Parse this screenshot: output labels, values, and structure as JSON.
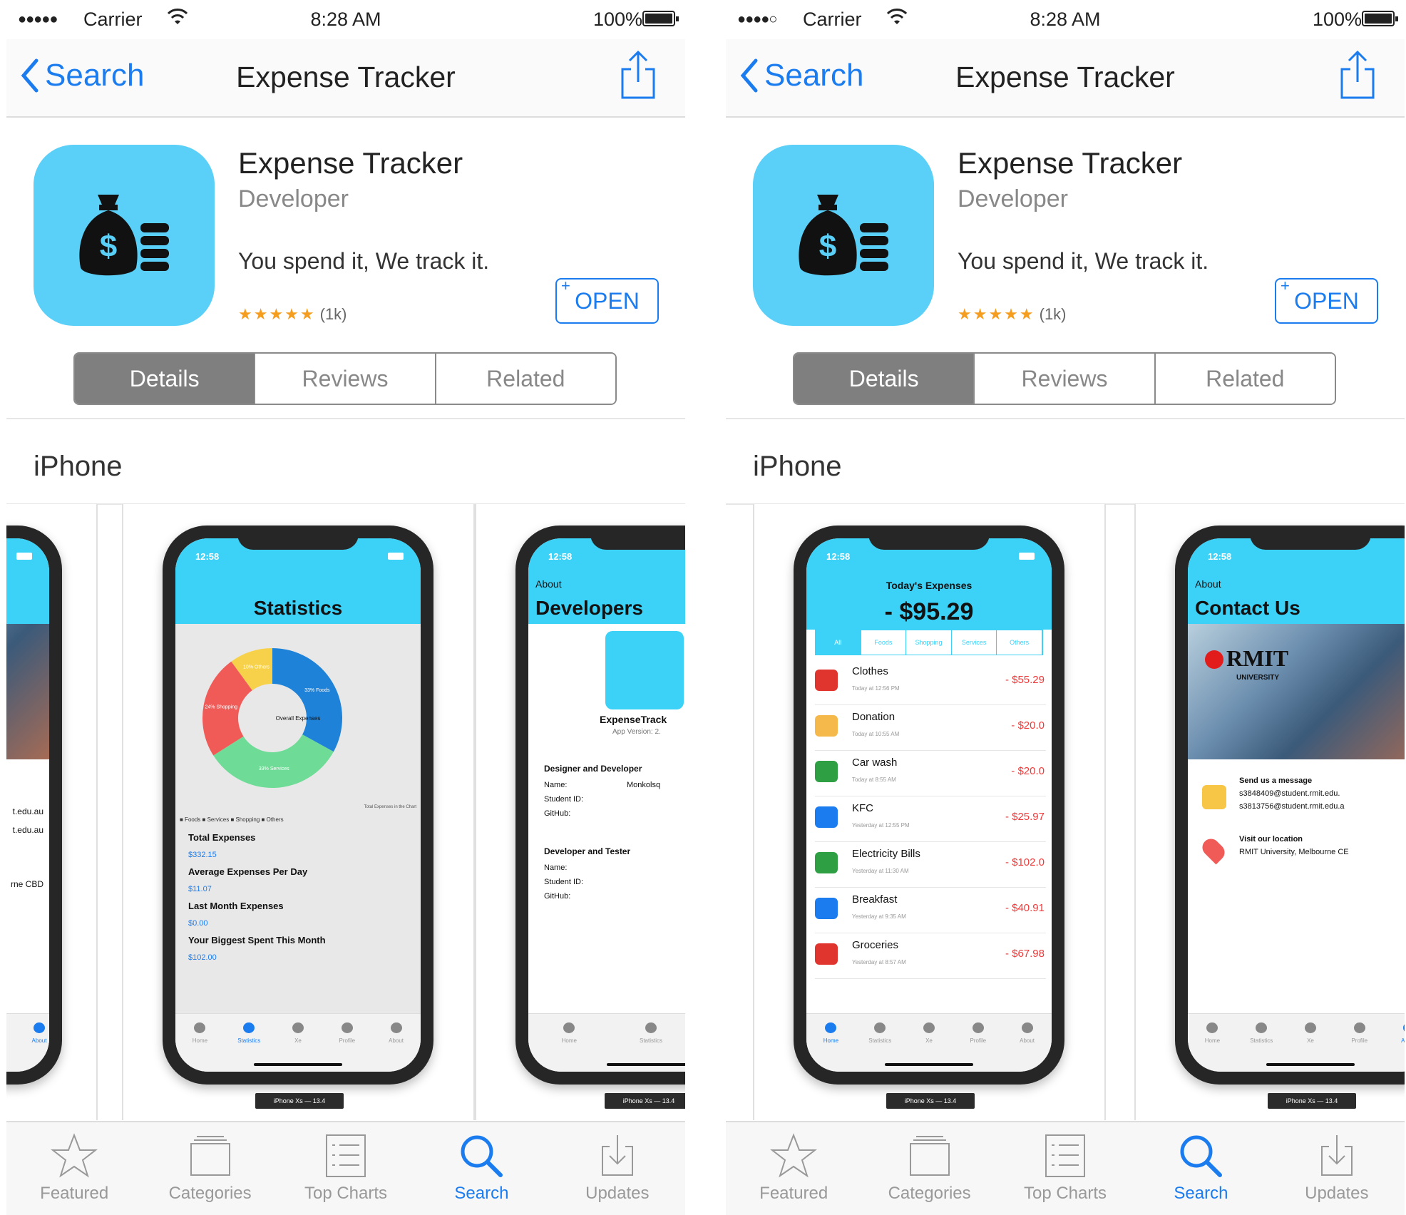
{
  "status": {
    "signal_left": "●●●●●",
    "signal_right": "●●●●○",
    "carrier": "Carrier",
    "time": "8:28 AM",
    "battery": "100%"
  },
  "nav": {
    "back_label": "Search",
    "title": "Expense Tracker"
  },
  "app": {
    "name": "Expense Tracker",
    "developer": "Developer",
    "tagline": "You spend it, We track it.",
    "stars": "★★★★★",
    "rating_count": "(1k)",
    "open_label": "OPEN",
    "open_plus": "+"
  },
  "segments": [
    {
      "label": "Details",
      "selected": true
    },
    {
      "label": "Reviews",
      "selected": false
    },
    {
      "label": "Related",
      "selected": false
    }
  ],
  "section_title": "iPhone",
  "screens": {
    "device_label": "iPhone Xs — 13.4",
    "statistics": {
      "time": "12:58",
      "title": "Statistics",
      "chart_center": "Overall Expenses",
      "chart_note": "Total Expenses in the Chart",
      "slices": [
        {
          "label": "33% Foods",
          "value": 33,
          "color": "#1e82d8"
        },
        {
          "label": "33% Services",
          "value": 33,
          "color": "#6edc96"
        },
        {
          "label": "24% Shopping",
          "value": 24,
          "color": "#f05a57"
        },
        {
          "label": "10% Others",
          "value": 10,
          "color": "#f7d14a"
        }
      ],
      "legend": "■ Foods ■ Services ■ Shopping ■ Others",
      "rows": [
        {
          "label": "Total Expenses",
          "value": "$332.15"
        },
        {
          "label": "Average Expenses Per Day",
          "value": "$11.07"
        },
        {
          "label": "Last Month Expenses",
          "value": "$0.00"
        },
        {
          "label": "Your Biggest Spent This Month",
          "value": "$102.00"
        }
      ],
      "tabs": [
        "Home",
        "Statistics",
        "Xe",
        "Profile",
        "About"
      ]
    },
    "developers": {
      "time": "12:58",
      "back": "About",
      "title": "Developers",
      "app_name": "ExpenseTrack",
      "version": "App Version: 2.",
      "group1": "Designer and Developer",
      "group2": "Developer and Tester",
      "name_label": "Name:",
      "name_value": "Monkolsq",
      "student_label": "Student ID:",
      "github_label": "GitHub:"
    },
    "left_partial": {
      "lines": [
        "t.edu.au",
        "t.edu.au",
        "rne CBD"
      ],
      "tab": "About"
    },
    "today": {
      "time": "12:58",
      "header": "Today's Expenses",
      "amount": "- $95.29",
      "filters": [
        "All",
        "Foods",
        "Shopping",
        "Services",
        "Others"
      ],
      "items": [
        {
          "name": "Clothes",
          "time": "Today at 12:56 PM",
          "amount": "- $55.29",
          "color": "#e0342e"
        },
        {
          "name": "Donation",
          "time": "Today at 10:55 AM",
          "amount": "- $20.0",
          "color": "#f5b84a"
        },
        {
          "name": "Car wash",
          "time": "Today at 8:55 AM",
          "amount": "- $20.0",
          "color": "#2ea043"
        },
        {
          "name": "KFC",
          "time": "Yesterday at 12:55 PM",
          "amount": "- $25.97",
          "color": "#1b7cef"
        },
        {
          "name": "Electricity Bills",
          "time": "Yesterday at 11:30 AM",
          "amount": "- $102.0",
          "color": "#2ea043"
        },
        {
          "name": "Breakfast",
          "time": "Yesterday at 9:35 AM",
          "amount": "- $40.91",
          "color": "#1b7cef"
        },
        {
          "name": "Groceries",
          "time": "Yesterday at 8:57 AM",
          "amount": "- $67.98",
          "color": "#e0342e"
        }
      ]
    },
    "contact": {
      "time": "12:58",
      "back": "About",
      "title": "Contact Us",
      "logo": "RMIT",
      "logo_sub": "UNIVERSITY",
      "msg_title": "Send us a message",
      "email1": "s3848409@student.rmit.edu.",
      "email2": "s3813756@student.rmit.edu.a",
      "loc_title": "Visit our location",
      "loc_value": "RMIT University, Melbourne CE"
    }
  },
  "tabbar": [
    {
      "label": "Featured",
      "icon": "star-icon"
    },
    {
      "label": "Categories",
      "icon": "categories-icon"
    },
    {
      "label": "Top Charts",
      "icon": "list-icon"
    },
    {
      "label": "Search",
      "icon": "search-icon",
      "active": true
    },
    {
      "label": "Updates",
      "icon": "download-icon"
    }
  ],
  "colors": {
    "accent": "#1b7cef",
    "app_icon_bg": "#5acff7",
    "segment_selected": "#7f7f7f",
    "stars": "#f59d1f"
  }
}
